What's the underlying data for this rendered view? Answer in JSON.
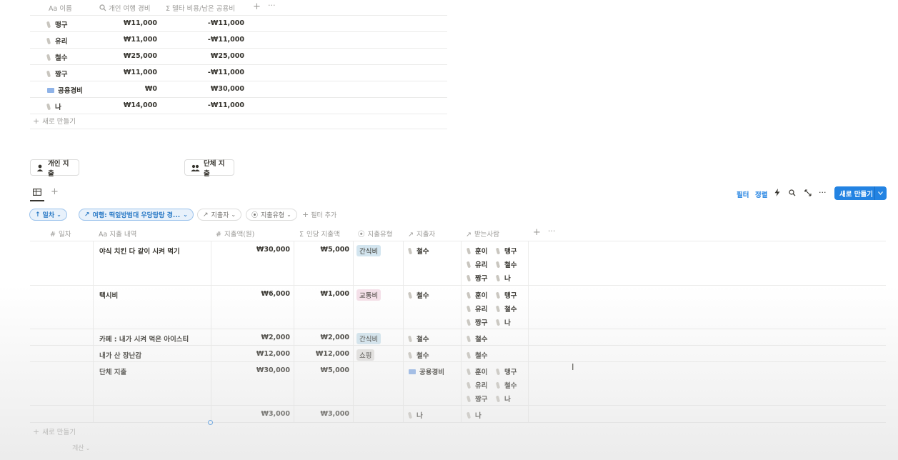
{
  "top_table": {
    "headers": [
      {
        "icon": "Aa",
        "label": "이름"
      },
      {
        "icon": "search",
        "label": "개인 여행 경비"
      },
      {
        "icon": "Σ",
        "label": "델타 비용/남은 공용비"
      }
    ],
    "rows": [
      {
        "name": "맹구",
        "icon": "page",
        "expense": "₩11,000",
        "delta": "-₩11,000"
      },
      {
        "name": "유리",
        "icon": "page",
        "expense": "₩11,000",
        "delta": "-₩11,000"
      },
      {
        "name": "철수",
        "icon": "page",
        "expense": "₩25,000",
        "delta": "₩25,000"
      },
      {
        "name": "짱구",
        "icon": "page",
        "expense": "₩11,000",
        "delta": "-₩11,000"
      },
      {
        "name": "공용경비",
        "icon": "folder",
        "expense": "₩0",
        "delta": "₩30,000"
      },
      {
        "name": "나",
        "icon": "page",
        "expense": "₩14,000",
        "delta": "-₩11,000"
      }
    ],
    "new_label": "새로 만들기"
  },
  "buttons": {
    "personal": "개인 지출",
    "group": "단체 지출"
  },
  "toolbar": {
    "filter": "필터",
    "sort": "정렬",
    "new": "새로 만들기"
  },
  "filters": {
    "sort_pill": "일차",
    "trip_pill": "여행: 떡잎방범대 우당탕탕 경...",
    "payer_pill": "지출자",
    "type_pill": "지출유형",
    "add_filter": "필터 추가"
  },
  "main_table": {
    "headers": [
      {
        "icon": "#",
        "label": "일차"
      },
      {
        "icon": "Aa",
        "label": "지출 내역"
      },
      {
        "icon": "#",
        "label": "지출액(원)"
      },
      {
        "icon": "Σ",
        "label": "인당 지출액"
      },
      {
        "icon": "select",
        "label": "지출유형"
      },
      {
        "icon": "↗",
        "label": "지출자"
      },
      {
        "icon": "↗",
        "label": "받는사람"
      }
    ],
    "rows": [
      {
        "desc": "야식 치킨 다 같이 시켜 먹기",
        "amount": "₩30,000",
        "per": "₩5,000",
        "type": "간식비",
        "type_color": "#d3e5ef",
        "payer": "철수",
        "payer_icon": "page",
        "receivers": [
          "훈이",
          "맹구",
          "유리",
          "철수",
          "짱구",
          "나"
        ]
      },
      {
        "desc": "택시비",
        "amount": "₩6,000",
        "per": "₩1,000",
        "type": "교통비",
        "type_color": "#f5e0e9",
        "payer": "철수",
        "payer_icon": "page",
        "receivers": [
          "훈이",
          "맹구",
          "유리",
          "철수",
          "짱구",
          "나"
        ]
      },
      {
        "desc": "카페 : 내가 시켜 먹은 아이스티",
        "amount": "₩2,000",
        "per": "₩2,000",
        "type": "간식비",
        "type_color": "#d3e5ef",
        "payer": "철수",
        "payer_icon": "page",
        "receivers": [
          "철수"
        ]
      },
      {
        "desc": "내가 산 장난감",
        "amount": "₩12,000",
        "per": "₩12,000",
        "type": "쇼핑",
        "type_color": "#e3e2e0",
        "payer": "철수",
        "payer_icon": "page",
        "receivers": [
          "철수"
        ]
      },
      {
        "desc": "단체 지출",
        "amount": "₩30,000",
        "per": "₩5,000",
        "type": "",
        "type_color": "",
        "payer": "공용경비",
        "payer_icon": "folder",
        "receivers": [
          "훈이",
          "맹구",
          "유리",
          "철수",
          "짱구",
          "나"
        ]
      },
      {
        "desc": "",
        "amount": "₩3,000",
        "per": "₩3,000",
        "type": "",
        "type_color": "",
        "payer": "나",
        "payer_icon": "page",
        "receivers": [
          "나"
        ]
      }
    ],
    "new_label": "새로 만들기",
    "calc_label": "계산"
  }
}
